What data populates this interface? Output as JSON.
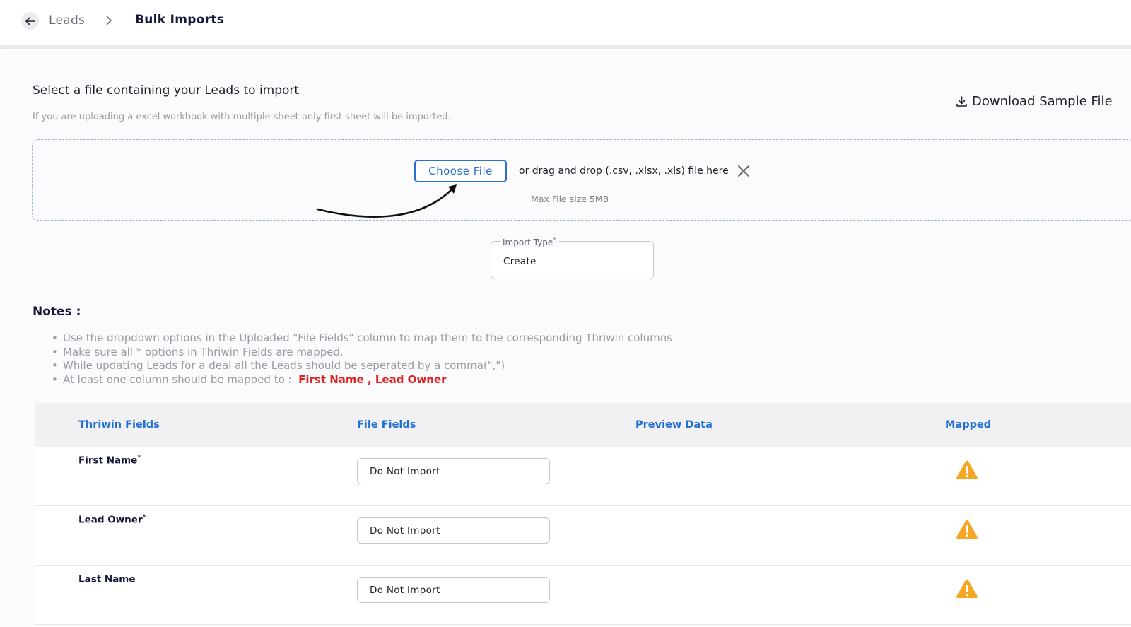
{
  "breadcrumb": {
    "root": "Leads",
    "current": "Bulk Imports"
  },
  "upload": {
    "title": "Select a file containing your Leads to import",
    "hint": "If you are uploading a excel workbook with multiple sheet only first sheet will be imported.",
    "download_label": "Download Sample File",
    "choose_label": "Choose File",
    "drag_text": "or drag and drop (.csv, .xlsx, .xls) file here",
    "max_size": "Max File size 5MB"
  },
  "import_type": {
    "label": "Import Type",
    "required_mark": "*",
    "value": "Create"
  },
  "notes": {
    "title": "Notes :",
    "items": [
      "Use the dropdown options in the Uploaded \"File Fields\" column to map them to the corresponding Thriwin columns.",
      "Make sure all * options in Thriwin Fields are mapped.",
      "While updating Leads for a deal all the Leads should be seperated by a comma(\",\")",
      "At least one column should be mapped to :"
    ],
    "required_fields": "First Name , Lead Owner"
  },
  "table": {
    "headers": [
      "Thriwin Fields",
      "File Fields",
      "Preview Data",
      "Mapped"
    ],
    "rows": [
      {
        "field": "First Name",
        "required": "*",
        "file_field": "Do Not Import"
      },
      {
        "field": "Lead Owner",
        "required": "*",
        "file_field": "Do Not Import"
      },
      {
        "field": "Last Name",
        "required": "",
        "file_field": "Do Not Import"
      }
    ]
  },
  "colors": {
    "accent": "#2b6fd1",
    "header_text": "#1f6fd6",
    "required": "#e02424",
    "warning": "#f5a623"
  }
}
